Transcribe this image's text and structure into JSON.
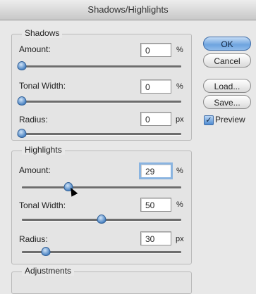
{
  "window": {
    "title": "Shadows/Highlights"
  },
  "shadows": {
    "title": "Shadows",
    "amount": {
      "label": "Amount:",
      "value": "0",
      "unit": "%",
      "level": 0.0
    },
    "tonal_width": {
      "label": "Tonal Width:",
      "value": "0",
      "unit": "%",
      "level": 0.0
    },
    "radius": {
      "label": "Radius:",
      "value": "0",
      "unit": "px",
      "level": 0.0
    }
  },
  "highlights": {
    "title": "Highlights",
    "amount": {
      "label": "Amount:",
      "value": "29",
      "unit": "%",
      "level": 0.29
    },
    "tonal_width": {
      "label": "Tonal Width:",
      "value": "50",
      "unit": "%",
      "level": 0.5
    },
    "radius": {
      "label": "Radius:",
      "value": "30",
      "unit": "px",
      "level": 0.15
    }
  },
  "adjustments": {
    "title": "Adjustments"
  },
  "buttons": {
    "ok": "OK",
    "cancel": "Cancel",
    "load": "Load...",
    "save": "Save..."
  },
  "preview": {
    "label": "Preview",
    "checked": true
  },
  "colors": {
    "accent": "#5a93d6",
    "background": "#e8e8e8"
  }
}
